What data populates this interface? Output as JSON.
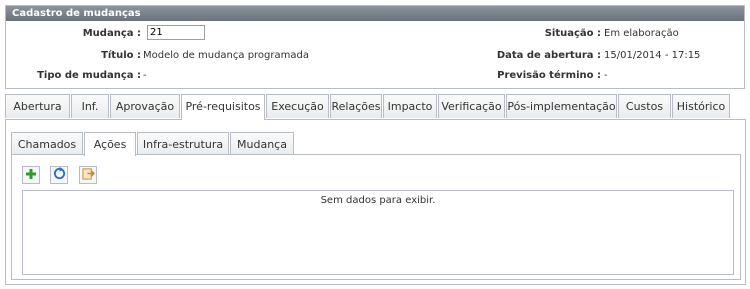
{
  "panel": {
    "title": "Cadastro de mudanças",
    "fields": {
      "mudanca_label": "Mudança :",
      "mudanca_value": "21",
      "titulo_label": "Título :",
      "titulo_value": "Modelo de mudança programada",
      "tipo_label": "Tipo de mudança :",
      "tipo_value": "-",
      "situacao_label": "Situação :",
      "situacao_value": "Em elaboração",
      "abertura_label": "Data de abertura :",
      "abertura_value": "15/01/2014 - 17:15",
      "previsao_label": "Previsão término :",
      "previsao_value": "-"
    }
  },
  "main_tabs": [
    {
      "label": "Abertura"
    },
    {
      "label": "Inf."
    },
    {
      "label": "Aprovação"
    },
    {
      "label": "Pré-requisitos",
      "active": true
    },
    {
      "label": "Execução"
    },
    {
      "label": "Relações"
    },
    {
      "label": "Impacto"
    },
    {
      "label": "Verificação"
    },
    {
      "label": "Pós-implementação"
    },
    {
      "label": "Custos"
    },
    {
      "label": "Histórico"
    }
  ],
  "sub_tabs": [
    {
      "label": "Chamados"
    },
    {
      "label": "Ações",
      "active": true
    },
    {
      "label": "Infra-estrutura"
    },
    {
      "label": "Mudança"
    }
  ],
  "toolbar": {
    "buttons": [
      {
        "icon": "add-icon",
        "color": "#2e9c2e"
      },
      {
        "icon": "refresh-icon",
        "color": "#2a6fd1"
      },
      {
        "icon": "export-icon",
        "color": "#c98a2b"
      }
    ]
  },
  "grid": {
    "empty_message": "Sem dados para exibir."
  }
}
